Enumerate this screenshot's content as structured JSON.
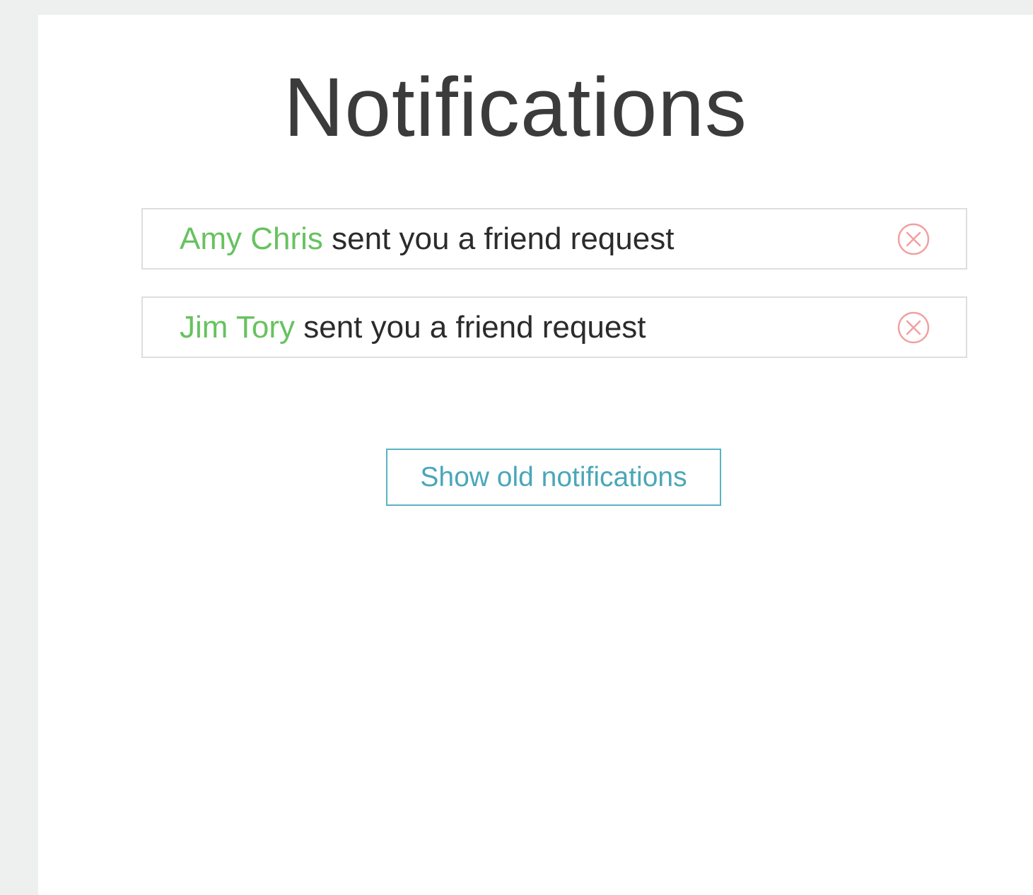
{
  "page": {
    "title": "Notifications"
  },
  "notifications": [
    {
      "name": "Amy Chris",
      "message": "sent you a friend request",
      "dismiss_icon": "close-circle-icon"
    },
    {
      "name": "Jim Tory",
      "message": "sent you a friend request",
      "dismiss_icon": "close-circle-icon"
    }
  ],
  "actions": {
    "show_old_label": "Show old notifications"
  },
  "colors": {
    "name_accent": "#67c25f",
    "dismiss_icon": "#f2a0a0",
    "button_accent": "#5ab2c2",
    "text": "#2b2b2b",
    "background": "#eef0ef"
  }
}
